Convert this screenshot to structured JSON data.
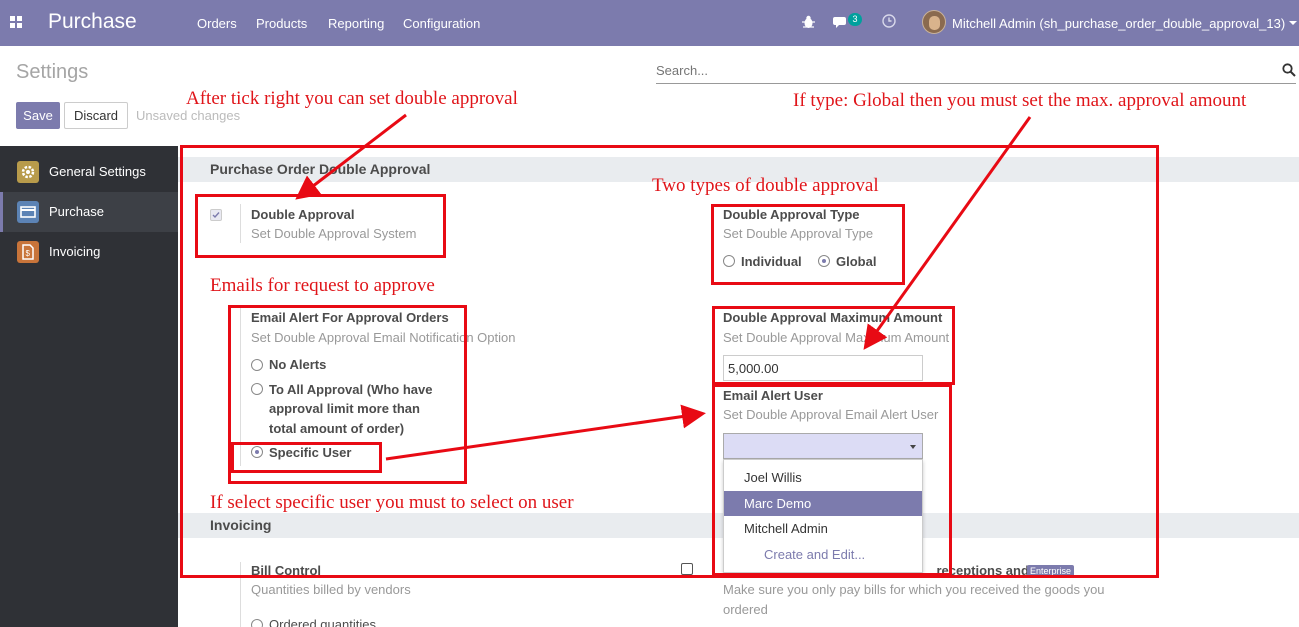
{
  "navbar": {
    "app_name": "Purchase",
    "menu": [
      "Orders",
      "Products",
      "Reporting",
      "Configuration"
    ],
    "messages_count": "3",
    "user": "Mitchell Admin (sh_purchase_order_double_approval_13)",
    "background": "#7c7bad"
  },
  "control": {
    "title": "Settings",
    "search_placeholder": "Search...",
    "save_label": "Save",
    "discard_label": "Discard",
    "unsaved_label": "Unsaved changes"
  },
  "sidebar": {
    "items": [
      {
        "label": "General Settings",
        "icon": "gear-icon",
        "color": "#b89b4b"
      },
      {
        "label": "Purchase",
        "icon": "card-icon",
        "color": "#5c83b5",
        "active": true
      },
      {
        "label": "Invoicing",
        "icon": "invoice-icon",
        "color": "#c8743a"
      }
    ]
  },
  "double_approval_section": {
    "title": "Purchase Order Double Approval",
    "double_approval": {
      "label": "Double Approval",
      "help": "Set Double Approval System",
      "checked": true
    },
    "approval_type": {
      "label": "Double Approval Type",
      "help": "Set Double Approval Type",
      "options": [
        "Individual",
        "Global"
      ],
      "selected": "Global"
    },
    "email_alert": {
      "label": "Email Alert For Approval Orders",
      "help": "Set Double Approval Email Notification Option",
      "options": [
        {
          "lines": [
            "No Alerts"
          ]
        },
        {
          "lines": [
            "To All Approval (Who have",
            "approval limit more than",
            "total amount of order)"
          ]
        },
        {
          "lines": [
            "Specific User"
          ]
        }
      ],
      "selected": "Specific User"
    },
    "max_amount": {
      "label": "Double Approval Maximum Amount",
      "help": "Set Double Approval Maximum Amount",
      "value": "5,000.00"
    },
    "alert_user": {
      "label": "Email Alert User",
      "help": "Set Double Approval Email Alert User",
      "dropdown_items": [
        "Joel Willis",
        "Marc Demo",
        "Mitchell Admin"
      ],
      "highlighted": "Marc Demo",
      "create_label": "Create and Edit..."
    }
  },
  "invoicing_section": {
    "title": "Invoicing",
    "bill_control": {
      "label": "Bill Control",
      "help": "Quantities billed by vendors",
      "option": "Ordered quantities"
    },
    "three_way": {
      "label_visible": "... receptions and bills",
      "badge": "Enterprise",
      "help_lines": [
        "Make sure you only pay bills for which you received the goods you",
        "ordered"
      ]
    }
  },
  "annotations": {
    "tick": "After tick right you can set double approval",
    "global": "If type: Global then you must set the max. approval amount",
    "two_types": "Two types of double approval",
    "emails": "Emails for request to approve",
    "specific": "If select specific user you must to select on user",
    "color": "#e0151a"
  }
}
